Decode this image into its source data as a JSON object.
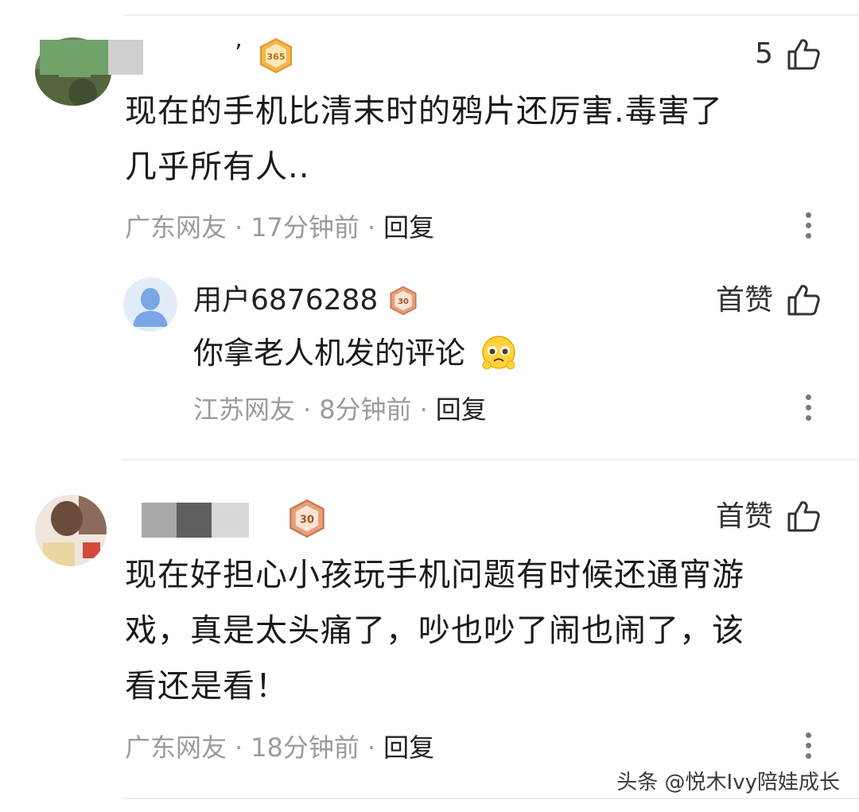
{
  "comments": [
    {
      "username_suffix": "’",
      "badge_level": "365",
      "like_label": "5",
      "text_line1": "现在的手机比清末时的鸦片还厉害.毒害了",
      "text_line2": "几乎所有人..",
      "location": "广东网友",
      "time": "17分钟前",
      "reply_label": "回复",
      "replies": [
        {
          "username": "用户6876288",
          "badge_level": "30",
          "like_label": "首赞",
          "text": "你拿老人机发的评论",
          "emoji_icon": "pleading-face-emoji",
          "location": "江苏网友",
          "time": "8分钟前",
          "reply_label": "回复"
        }
      ]
    },
    {
      "badge_level": "30",
      "like_label": "首赞",
      "text_line1": "现在好担心小孩玩手机问题有时候还通宵游",
      "text_line2": "戏，真是太头痛了，吵也吵了闹也闹了，该",
      "text_line3": "看还是看！",
      "location": "广东网友",
      "time": "18分钟前",
      "reply_label": "回复"
    }
  ],
  "watermark": "头条 @悦木Ivy陪娃成长",
  "separator": "·",
  "colors": {
    "badge_gold": "#e8a63a",
    "badge_bronze": "#c8734a",
    "meta_gray": "#9b9b9b"
  }
}
